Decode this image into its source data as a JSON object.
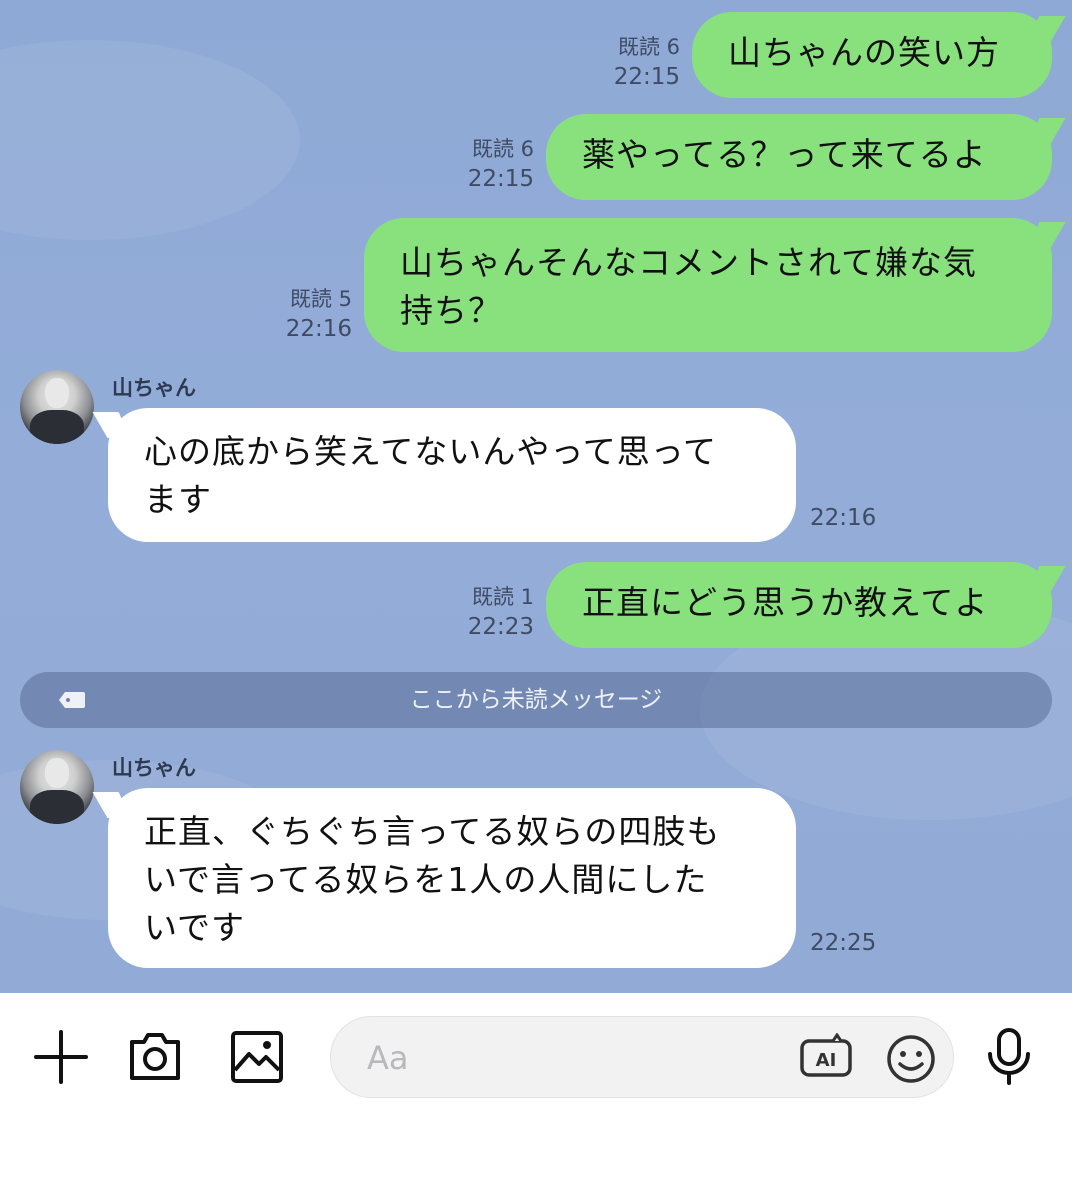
{
  "messages": [
    {
      "dir": "out",
      "read": "既読 6",
      "time": "22:15",
      "lines": [
        "山ちゃんの笑い方"
      ]
    },
    {
      "dir": "out",
      "read": "既読 6",
      "time": "22:15",
      "lines": [
        "薬やってる？って来てるよ"
      ]
    },
    {
      "dir": "out",
      "read": "既読 5",
      "time": "22:16",
      "lines": [
        "山ちゃんそんなコメントされて嫌な気",
        "持ち？"
      ]
    },
    {
      "dir": "in",
      "sender": "山ちゃん",
      "time": "22:16",
      "lines": [
        "心の底から笑えてないんやって思って",
        "ます"
      ]
    },
    {
      "dir": "out",
      "read": "既読 1",
      "time": "22:23",
      "lines": [
        "正直にどう思うか教えてよ"
      ]
    },
    {
      "dir": "in",
      "sender": "山ちゃん",
      "time": "22:25",
      "lines": [
        "正直、ぐちぐち言ってる奴らの四肢も",
        "いで言ってる奴らを1人の人間にした",
        "いです"
      ]
    }
  ],
  "unread_divider": "ここから未読メッセージ",
  "input": {
    "placeholder": "Aa",
    "ai_label": "AI"
  },
  "colors": {
    "chat_bg": "#8fa9d6",
    "outgoing_bubble": "#89e17d",
    "incoming_bubble": "#ffffff"
  },
  "icons": [
    "plus-icon",
    "camera-icon",
    "image-icon",
    "ai-icon",
    "emoji-icon",
    "mic-icon"
  ]
}
